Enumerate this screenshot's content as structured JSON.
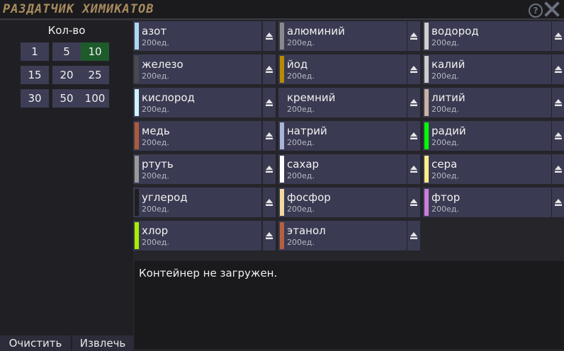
{
  "window": {
    "title": "РАЗДАТЧИК ХИМИКАТОВ",
    "help_glyph": "?"
  },
  "amount": {
    "label": "Кол-во",
    "options": [
      "1",
      "5",
      "10",
      "15",
      "20",
      "25",
      "30",
      "50",
      "100"
    ],
    "selected": "10"
  },
  "actions": {
    "clear_label": "Очистить",
    "eject_label": "Извлечь"
  },
  "chemicals": [
    {
      "name": "азот",
      "qty": "200ед.",
      "color": "#aed8ee"
    },
    {
      "name": "алюминий",
      "qty": "200ед.",
      "color": "#8a8a8a"
    },
    {
      "name": "водород",
      "qty": "200ед.",
      "color": "#cfcfcf"
    },
    {
      "name": "железо",
      "qty": "200ед.",
      "color": "#4a4a4a"
    },
    {
      "name": "йод",
      "qty": "200ед.",
      "color": "#b98b00"
    },
    {
      "name": "калий",
      "qty": "200ед.",
      "color": "#cccccc"
    },
    {
      "name": "кислород",
      "qty": "200ед.",
      "color": "#cff3ff"
    },
    {
      "name": "кремний",
      "qty": "200ед.",
      "color": "#3a3a52"
    },
    {
      "name": "литий",
      "qty": "200ед.",
      "color": "#c9b3a4"
    },
    {
      "name": "медь",
      "qty": "200ед.",
      "color": "#b05a3c"
    },
    {
      "name": "натрий",
      "qty": "200ед.",
      "color": "#a9b4d6"
    },
    {
      "name": "радий",
      "qty": "200ед.",
      "color": "#00ff00"
    },
    {
      "name": "ртуть",
      "qty": "200ед.",
      "color": "#9a9a9a"
    },
    {
      "name": "сахар",
      "qty": "200ед.",
      "color": "#ffffff"
    },
    {
      "name": "сера",
      "qty": "200ед.",
      "color": "#ffee88"
    },
    {
      "name": "углерод",
      "qty": "200ед.",
      "color": "#1f1f1f"
    },
    {
      "name": "фосфор",
      "qty": "200ед.",
      "color": "#f3d8a0"
    },
    {
      "name": "фтор",
      "qty": "200ед.",
      "color": "#c87fd8"
    },
    {
      "name": "хлор",
      "qty": "200ед.",
      "color": "#a8f000"
    },
    {
      "name": "этанол",
      "qty": "200ед.",
      "color": "#b7603d"
    }
  ],
  "status": {
    "message": "Контейнер не загружен."
  },
  "icons": {
    "eject": "eject-icon",
    "help": "help-icon",
    "close": "close-icon"
  }
}
